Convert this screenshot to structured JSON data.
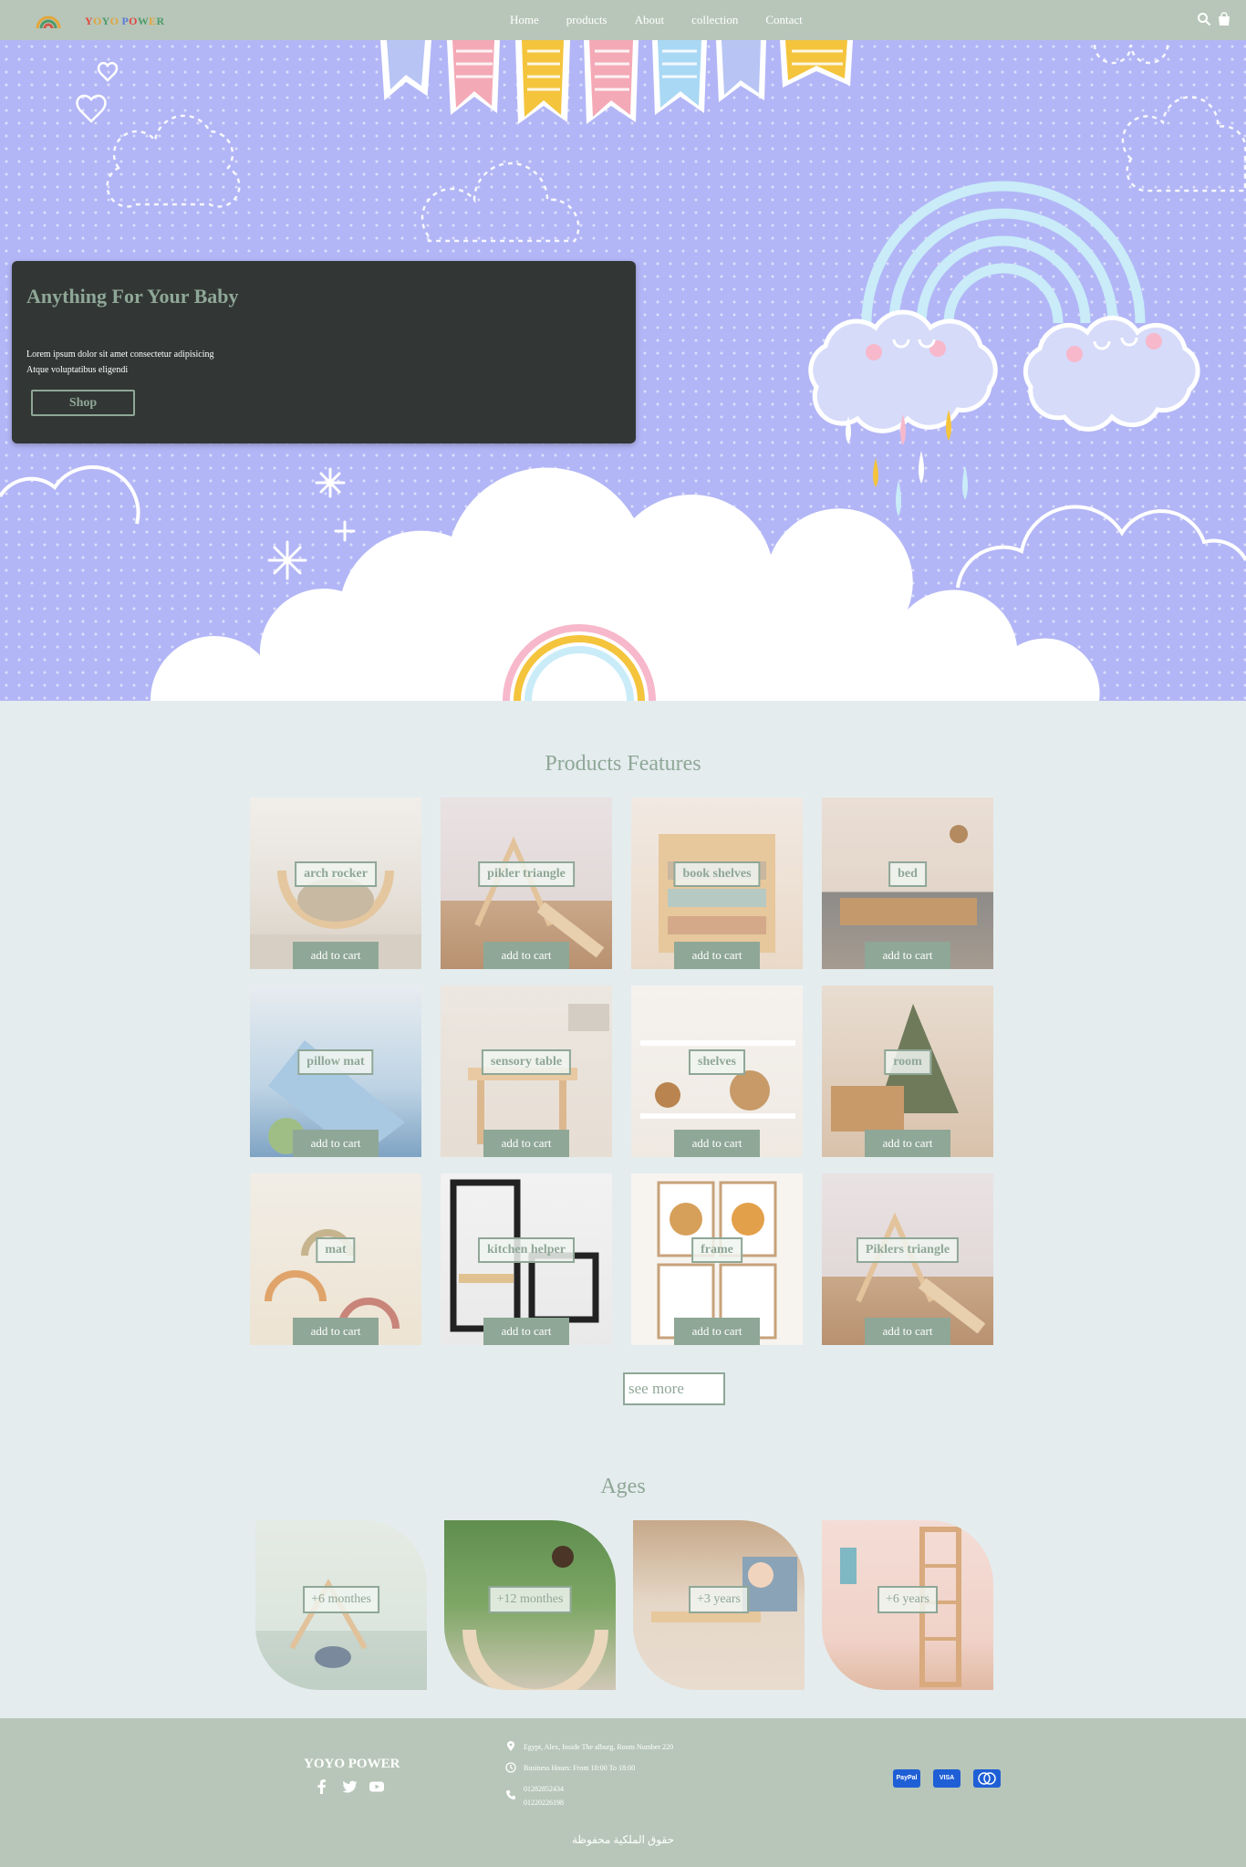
{
  "nav": {
    "brand": "YOYO POWER",
    "links": [
      "Home",
      "products",
      "About",
      "collection",
      "Contact"
    ],
    "icons": [
      "search-icon",
      "shopping-bag-icon"
    ]
  },
  "hero": {
    "title": "Anything For Your Baby",
    "subtitle_line1": "Lorem ipsum dolor sit amet consectetur adipisicing",
    "subtitle_line2": "Atque voluptatibus eligendi",
    "button": "Shop"
  },
  "products": {
    "title": "Products Features",
    "button_label": "add to cart",
    "items": [
      {
        "name": "arch rocker"
      },
      {
        "name": "pikler triangle"
      },
      {
        "name": "book shelves"
      },
      {
        "name": "bed"
      },
      {
        "name": "pillow mat"
      },
      {
        "name": "sensory table"
      },
      {
        "name": "shelves"
      },
      {
        "name": "room"
      },
      {
        "name": "mat"
      },
      {
        "name": "kitchen helper"
      },
      {
        "name": "frame"
      },
      {
        "name": "Piklers triangle"
      }
    ],
    "see_more": "see more"
  },
  "ages": {
    "title": "Ages",
    "items": [
      {
        "label": "+6 monthes"
      },
      {
        "label": "+12 monthes"
      },
      {
        "label": "+3 years"
      },
      {
        "label": "+6 years"
      }
    ]
  },
  "footer": {
    "brand": "YOYO POWER",
    "social": [
      "facebook-icon",
      "twitter-icon",
      "youtube-icon"
    ],
    "address": "Egypt, Alex, Inside The alburg, Room Number 220",
    "hours": "Business Hours: From 10:00 To 18:00",
    "phone1": "01282852434",
    "phone2": "01220226198",
    "payments": [
      "PayPal",
      "VISA",
      "MasterCard"
    ],
    "copyright": "حقوق الملكية محفوظة"
  },
  "colors": {
    "accent": "#8fa797",
    "nav_bg": "#b7c6b8",
    "hero_bg": "#b2b6f6",
    "page_bg": "#e4ecee"
  }
}
